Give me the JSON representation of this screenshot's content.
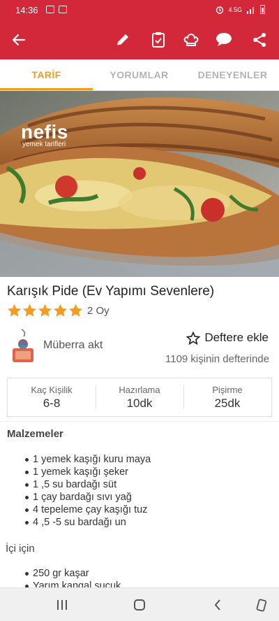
{
  "status_bar": {
    "time": "14:36",
    "network": "4.5G"
  },
  "tabs": [
    {
      "label": "TARİF"
    },
    {
      "label": "YORUMLAR"
    },
    {
      "label": "DENEYENLER"
    }
  ],
  "hero": {
    "logo_main": "nefis",
    "logo_sub": "yemek tarifleri"
  },
  "recipe": {
    "title": "Karışık Pide (Ev Yapımı Sevenlere)",
    "rating_stars": 5,
    "rating_count": "2 Oy",
    "author": "Müberra akt",
    "add_to_book": "Deftere ekle",
    "book_count": "1109 kişinin defterinde"
  },
  "info": {
    "servings_label": "Kaç Kişilik",
    "servings_value": "6-8",
    "prep_label": "Hazırlama",
    "prep_value": "10dk",
    "cook_label": "Pişirme",
    "cook_value": "25dk"
  },
  "ingredients": {
    "title": "Malzemeler",
    "items": [
      "1 yemek kaşığı kuru maya",
      "1 yemek kaşığı şeker",
      "1 ,5 su bardağı süt",
      "1 çay bardağı sıvı yağ",
      "4 tepeleme çay kaşığı tuz",
      "4 ,5 -5 su bardağı un"
    ],
    "filling_title": "İçi için",
    "filling_items": [
      "250 gr kaşar",
      "Yarım kangal sucuk"
    ]
  },
  "colors": {
    "brand": "#d3273a",
    "accent": "#f39c24",
    "star": "#f39c24"
  }
}
